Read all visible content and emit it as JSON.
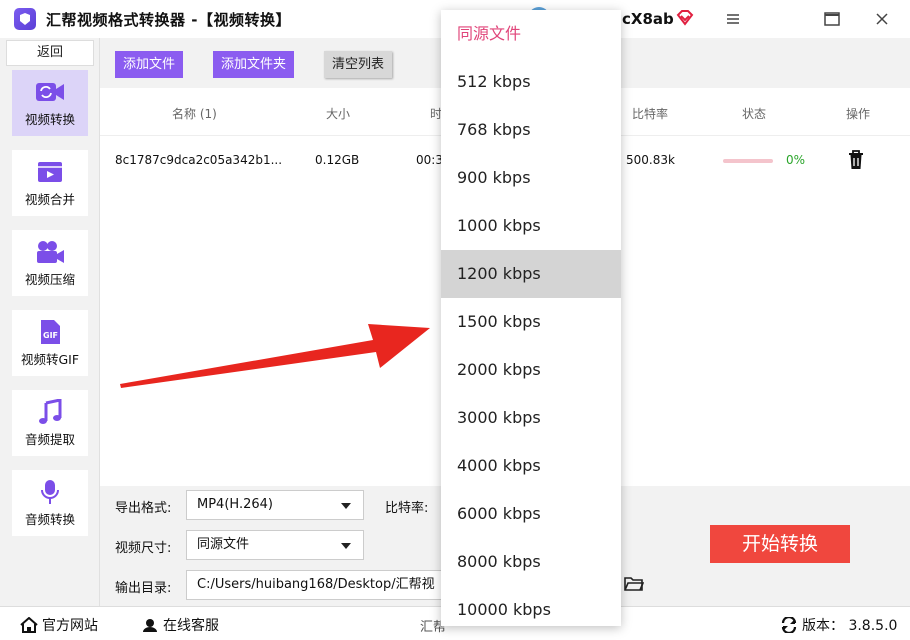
{
  "title_bar": {
    "app_title": "汇帮视频格式转换器 -【视频转换】",
    "username": "cX8ab",
    "buttons": [
      "menu",
      "maximize",
      "close"
    ]
  },
  "sidebar": {
    "back_label": "返回",
    "items": [
      {
        "label": "视频转换",
        "icon": "video-convert-icon",
        "active": true
      },
      {
        "label": "视频合并",
        "icon": "video-merge-icon",
        "active": false
      },
      {
        "label": "视频压缩",
        "icon": "video-compress-icon",
        "active": false
      },
      {
        "label": "视频转GIF",
        "icon": "gif-icon",
        "active": false
      },
      {
        "label": "音频提取",
        "icon": "music-icon",
        "active": false
      },
      {
        "label": "音频转换",
        "icon": "microphone-icon",
        "active": false
      }
    ]
  },
  "toolbar": {
    "add_file": "添加文件",
    "add_folder": "添加文件夹",
    "clear_list": "清空列表"
  },
  "table": {
    "headers": {
      "name": "名称 (1)",
      "size": "大小",
      "duration": "时",
      "bitrate": "比特率",
      "status": "状态",
      "actions": "操作"
    },
    "rows": [
      {
        "name": "8c1787c9dca2c05a342b1...",
        "size": "0.12GB",
        "duration": "00:3",
        "bitrate": "500.83k",
        "progress": 0,
        "progress_label": "0%"
      }
    ]
  },
  "settings": {
    "format_label": "导出格式:",
    "format_value": "MP4(H.264)",
    "bitrate_label": "比特率:",
    "size_label": "视频尺寸:",
    "size_value": "同源文件",
    "output_label": "输出目录:",
    "output_value": "C:/Users/huibang168/Desktop/汇帮视",
    "start_button": "开始转换"
  },
  "statusbar": {
    "website": "官方网站",
    "support": "在线客服",
    "middle_text": "汇帮",
    "version": "版本： 3.8.5.0"
  },
  "dropdown": {
    "options": [
      "同源文件",
      "512 kbps",
      "768 kbps",
      "900 kbps",
      "1000 kbps",
      "1200 kbps",
      "1500 kbps",
      "2000 kbps",
      "3000 kbps",
      "4000 kbps",
      "6000 kbps",
      "8000 kbps",
      "10000 kbps"
    ],
    "highlighted_index": 5
  },
  "colors": {
    "accent_purple": "#8b5cf0",
    "start_red": "#f0473e",
    "progress_pink": "#e94b6a",
    "percent_green": "#2aa52a",
    "first_option_pink": "#e0457a",
    "arrow_red": "#e8261f"
  }
}
